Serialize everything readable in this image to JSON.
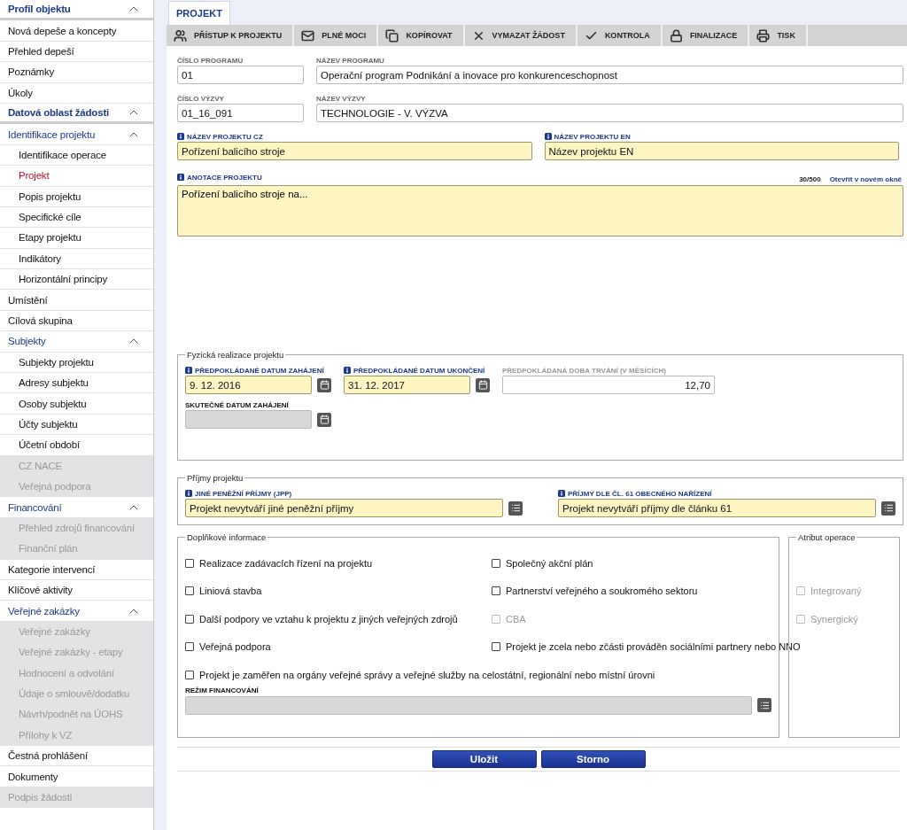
{
  "sidebar": {
    "items": [
      {
        "label": "Profil objektu",
        "kind": "section",
        "expanded": true,
        "children": [
          {
            "label": "Nová depeše a koncepty"
          },
          {
            "label": "Přehled depeší"
          },
          {
            "label": "Poznámky"
          },
          {
            "label": "Úkoly"
          }
        ]
      },
      {
        "label": "Datová oblast žádosti",
        "kind": "section",
        "expanded": true,
        "children": [
          {
            "label": "Identifikace projektu",
            "kind": "group",
            "expanded": true,
            "children": [
              {
                "label": "Identifikace operace",
                "selected": false
              },
              {
                "label": "Projekt",
                "selected": true
              },
              {
                "label": "Popis projektu",
                "selected": false
              },
              {
                "label": "Specifické cíle",
                "selected": false
              },
              {
                "label": "Etapy projektu",
                "selected": false
              },
              {
                "label": "Indikátory",
                "selected": false
              },
              {
                "label": "Horizontální principy",
                "selected": false
              }
            ]
          },
          {
            "label": "Umístění"
          },
          {
            "label": "Cílová skupina"
          },
          {
            "label": "Subjekty",
            "kind": "group",
            "expanded": true,
            "children": [
              {
                "label": "Subjekty projektu",
                "disabled": false
              },
              {
                "label": "Adresy subjektu",
                "disabled": false
              },
              {
                "label": "Osoby subjektu",
                "disabled": false
              },
              {
                "label": "Účty subjektu",
                "disabled": false
              },
              {
                "label": "Účetní období",
                "disabled": false
              },
              {
                "label": "CZ NACE",
                "disabled": true
              },
              {
                "label": "Veřejná podpora",
                "disabled": true
              }
            ]
          },
          {
            "label": "Financování",
            "kind": "group",
            "expanded": true,
            "children": [
              {
                "label": "Přehled zdrojů financování",
                "disabled": true
              },
              {
                "label": "Finanční plán",
                "disabled": true
              }
            ]
          },
          {
            "label": "Kategorie intervencí"
          },
          {
            "label": "Klíčové aktivity"
          },
          {
            "label": "Veřejné zakázky",
            "kind": "group",
            "expanded": true,
            "children": [
              {
                "label": "Veřejné zakázky",
                "disabled": true
              },
              {
                "label": "Veřejné zakázky - etapy",
                "disabled": true
              },
              {
                "label": "Hodnocení a odvolání",
                "disabled": true
              },
              {
                "label": "Údaje o smlouvě/dodatku",
                "disabled": true
              },
              {
                "label": "Návrh/podnět na ÚOHS",
                "disabled": true
              },
              {
                "label": "Přílohy k VZ",
                "disabled": true
              }
            ]
          },
          {
            "label": "Čestná prohlášení",
            "disabled": false
          },
          {
            "label": "Dokumenty",
            "disabled": false
          },
          {
            "label": "Podpis žádosti",
            "disabled": true
          }
        ]
      }
    ]
  },
  "tabs": [
    {
      "label": "PROJEKT",
      "selected": true
    }
  ],
  "toolbar": [
    {
      "label": "PŘÍSTUP K PROJEKTU",
      "kind": "people"
    },
    {
      "label": "PLNÉ MOCI",
      "kind": "mail"
    },
    {
      "label": "KOPÍROVAT",
      "kind": "copy"
    },
    {
      "label": "VYMAZAT ŽÁDOST",
      "kind": "delete"
    },
    {
      "label": "KONTROLA",
      "kind": "check"
    },
    {
      "label": "FINALIZACE",
      "kind": "lock"
    },
    {
      "label": "TISK",
      "kind": "print"
    }
  ],
  "field_rows": [
    {
      "kind": "code_name",
      "fields": [
        {
          "label": "ČÍSLO PROGRAMU",
          "value": "01",
          "required": false
        },
        {
          "label": "NÁZEV PROGRAMU",
          "value": "Operační program Podnikání a inovace pro konkurenceschopnost",
          "required": false
        }
      ]
    },
    {
      "kind": "code_name",
      "fields": [
        {
          "label": "ČÍSLO VÝZVY",
          "value": "01_16_091",
          "required": false
        },
        {
          "label": "NÁZEV VÝZVY",
          "value": "TECHNOLOGIE - V. VÝZVA",
          "required": false
        }
      ]
    },
    {
      "kind": "halves",
      "fields": [
        {
          "label": "NÁZEV PROJEKTU CZ",
          "value": "Pořízení balicího stroje",
          "required": true
        },
        {
          "label": "NÁZEV PROJEKTU EN",
          "value": "Název projektu EN",
          "required": true
        }
      ]
    }
  ],
  "annotation": {
    "label": "ANOTACE PROJEKTU",
    "required": true,
    "counter": "30/500",
    "link": "Otevřít v novém okně",
    "value": "Pořízení balicího stroje na..."
  },
  "physical": {
    "legend": "Fyzická realizace projektu",
    "rows": [
      [
        {
          "kind": "date",
          "label": "PŘEDPOKLÁDANÉ DATUM ZAHÁJENÍ",
          "value": "9. 12. 2016",
          "required": true,
          "disabled": false
        },
        {
          "kind": "date",
          "label": "PŘEDPOKLÁDANÉ DATUM UKONČENÍ",
          "value": "31. 12. 2017",
          "required": true,
          "disabled": false
        },
        {
          "kind": "number",
          "label": "PŘEDPOKLÁDANÁ DOBA TRVÁNÍ (V MĚSÍCÍCH)",
          "value": "12,70",
          "required": false,
          "readonly": true
        }
      ],
      [
        {
          "kind": "date",
          "label": "SKUTEČNÉ DATUM ZAHÁJENÍ",
          "required": false,
          "disabled": true
        }
      ]
    ]
  },
  "income": {
    "legend": "Příjmy projektu",
    "fields": [
      {
        "label": "JINÉ PENĚŽNÍ PŘÍJMY (JPP)",
        "value": "Projekt nevytváří jiné peněžní příjmy",
        "required": true
      },
      {
        "label": "PŘÍJMY DLE ČL. 61 OBECNÉHO NAŘÍZENÍ",
        "value": "Projekt nevytváří příjmy dle článku 61",
        "required": true
      }
    ]
  },
  "additional": {
    "legend": "Doplňkové informace",
    "checkboxes": [
      {
        "label": "Realizace zadávacích řízení na projektu",
        "checked": false,
        "disabled": false
      },
      {
        "label": "Společný akční plán",
        "checked": false,
        "disabled": false
      },
      {
        "label": "Liniová stavba",
        "checked": false,
        "disabled": false
      },
      {
        "label": "Partnerství veřejného a soukromého sektoru",
        "checked": false,
        "disabled": false
      },
      {
        "label": "Další podpory ve vztahu k projektu z jiných veřejných zdrojů",
        "checked": false,
        "disabled": false
      },
      {
        "label": "CBA",
        "checked": false,
        "disabled": true
      },
      {
        "label": "Veřejná podpora",
        "checked": false,
        "disabled": false
      },
      {
        "label": "Projekt je zcela nebo zčásti prováděn sociálními partnery nebo NNO",
        "checked": false,
        "disabled": false
      },
      {
        "label": "Projekt je zaměřen na orgány veřejné správy a veřejné služby na celostátní, regionální nebo místní úrovni",
        "checked": false,
        "disabled": false
      }
    ],
    "financing": {
      "label": "REŽIM FINANCOVÁNÍ",
      "disabled": true
    }
  },
  "attribute": {
    "legend": "Atribut operace",
    "checkboxes": [
      {
        "label": "Integrovaný",
        "checked": false,
        "disabled": true
      },
      {
        "label": "Synergický",
        "checked": false,
        "disabled": true
      }
    ]
  },
  "buttons": [
    "Uložit",
    "Storno"
  ]
}
